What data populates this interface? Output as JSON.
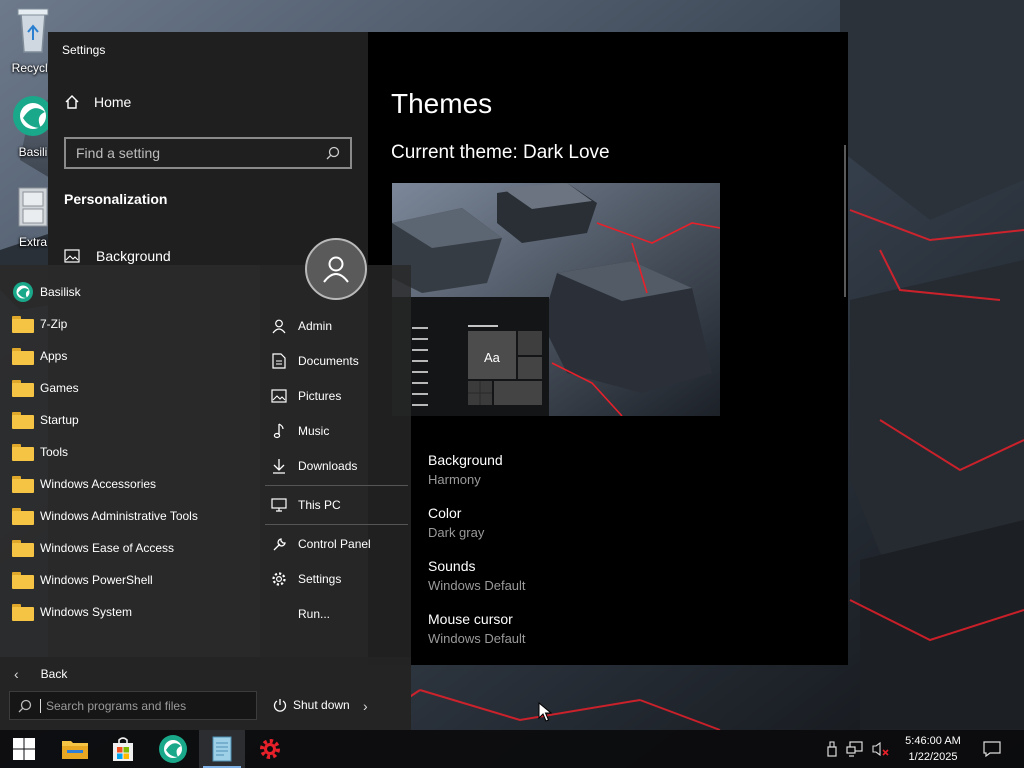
{
  "desktop": {
    "icons": [
      {
        "label": "Recycle"
      },
      {
        "label": "Basili"
      },
      {
        "label": "Extra"
      }
    ]
  },
  "settings": {
    "window_title": "Settings",
    "window_controls": {
      "minimize": "—",
      "maximize": "☐",
      "close": "✕"
    },
    "nav": {
      "home_label": "Home",
      "search_placeholder": "Find a setting",
      "section_heading": "Personalization",
      "items": [
        {
          "label": "Background"
        }
      ]
    },
    "content": {
      "page_title": "Themes",
      "current_theme": "Current theme: Dark Love",
      "preview_sample_text": "Aa",
      "properties": [
        {
          "name": "Background",
          "value": "Harmony"
        },
        {
          "name": "Color",
          "value": "Dark gray"
        },
        {
          "name": "Sounds",
          "value": "Windows Default"
        },
        {
          "name": "Mouse cursor",
          "value": "Windows Default"
        }
      ]
    }
  },
  "start_menu": {
    "programs": [
      {
        "label": "Basilisk",
        "icon": "basilisk-icon"
      },
      {
        "label": "7-Zip",
        "icon": "folder-icon"
      },
      {
        "label": "Apps",
        "icon": "folder-icon"
      },
      {
        "label": "Games",
        "icon": "folder-icon"
      },
      {
        "label": "Startup",
        "icon": "folder-icon"
      },
      {
        "label": "Tools",
        "icon": "folder-icon"
      },
      {
        "label": "Windows Accessories",
        "icon": "folder-icon"
      },
      {
        "label": "Windows Administrative Tools",
        "icon": "folder-icon"
      },
      {
        "label": "Windows Ease of Access",
        "icon": "folder-icon"
      },
      {
        "label": "Windows PowerShell",
        "icon": "folder-icon"
      },
      {
        "label": "Windows System",
        "icon": "folder-icon"
      }
    ],
    "places": [
      {
        "label": "Admin",
        "icon": "user-icon"
      },
      {
        "label": "Documents",
        "icon": "documents-icon"
      },
      {
        "label": "Pictures",
        "icon": "pictures-icon"
      },
      {
        "label": "Music",
        "icon": "music-icon"
      },
      {
        "label": "Downloads",
        "icon": "downloads-icon"
      },
      {
        "label": "This PC",
        "icon": "computer-icon"
      },
      {
        "label": "Control Panel",
        "icon": "wrench-icon"
      },
      {
        "label": "Settings",
        "icon": "gear-icon"
      },
      {
        "label": "Run...",
        "icon": "run-icon"
      }
    ],
    "back_label": "Back",
    "search_placeholder": "Search programs and files",
    "shutdown_label": "Shut down"
  },
  "taskbar": {
    "pinned": [
      {
        "name": "start-button",
        "icon": "windows-logo-icon"
      },
      {
        "name": "file-explorer",
        "icon": "folder-icon"
      },
      {
        "name": "microsoft-store",
        "icon": "store-bag-icon"
      },
      {
        "name": "basilisk-browser",
        "icon": "basilisk-icon"
      },
      {
        "name": "notepad-app",
        "icon": "notepad-icon",
        "active": true
      },
      {
        "name": "settings-app",
        "icon": "gear-icon"
      }
    ],
    "tray": {
      "icons": [
        "usb-device-icon",
        "network-icon",
        "volume-muted-icon"
      ],
      "time": "5:46:00 AM",
      "date": "1/22/2025"
    }
  },
  "colors": {
    "accent_red": "#e8202a",
    "folder_yellow": "#f6c444",
    "basilisk_teal": "#1aa88a",
    "taskbar_active": "#7fb1e6"
  }
}
